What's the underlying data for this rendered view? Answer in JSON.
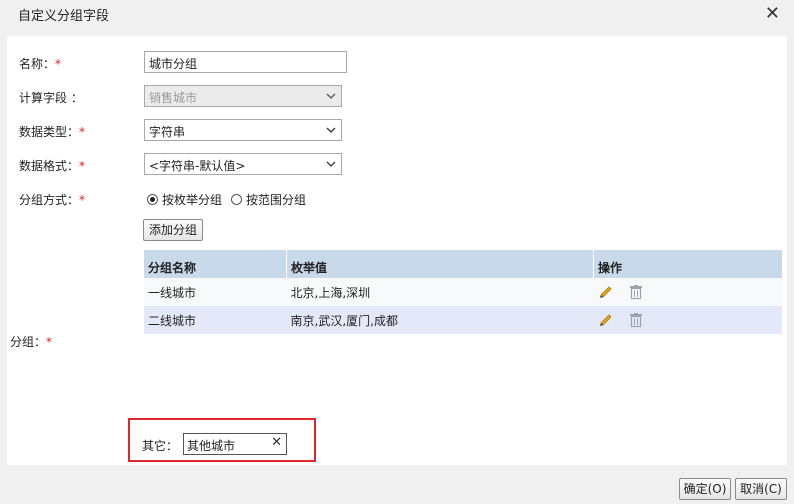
{
  "dialog": {
    "title": "自定义分组字段",
    "close_glyph": "✕"
  },
  "form": {
    "name": {
      "label": "名称：",
      "required": "*",
      "value": "城市分组"
    },
    "calc_field": {
      "label": "计算字段 ：",
      "value": "销售城市"
    },
    "data_type": {
      "label": "数据类型：",
      "required": "*",
      "value": "字符串"
    },
    "data_format": {
      "label": "数据格式：",
      "required": "*",
      "value": "<字符串-默认值>"
    },
    "group_mode": {
      "label": "分组方式：",
      "required": "*",
      "options": [
        {
          "label": "按枚举分组",
          "selected": true
        },
        {
          "label": "按范围分组",
          "selected": false
        }
      ]
    },
    "add_group_label": "添加分组",
    "groups_label": "分组：",
    "groups_required": "*",
    "table": {
      "headers": [
        "分组名称",
        "枚举值",
        "操作"
      ],
      "rows": [
        {
          "name": "一线城市",
          "values": "北京,上海,深圳"
        },
        {
          "name": "二线城市",
          "values": "南京,武汉,厦门,成都"
        }
      ]
    },
    "other": {
      "label": "其它：",
      "value": "其他城市",
      "clear_glyph": "✕"
    }
  },
  "footer": {
    "ok_label": "确定(O)",
    "cancel_label": "取消(C)"
  },
  "icons": {
    "edit": "pencil-icon",
    "delete": "trash-icon",
    "dropdown": "chevron-down-icon"
  },
  "colors": {
    "required": "#e02020",
    "table_header": "#c8d9ea",
    "row_alt": "#e3e9f8",
    "highlight_box": "#e0262e",
    "edit_icon": "#e8a317"
  }
}
